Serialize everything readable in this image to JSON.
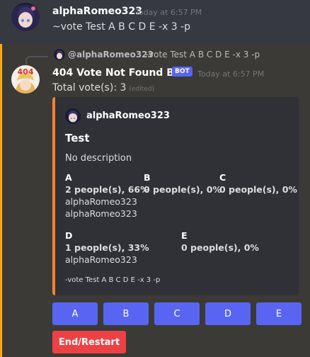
{
  "first_message": {
    "author": "alphaRomeo323",
    "timestamp": "Today at 6:57 PM",
    "content": "~vote Test A B C D E -x 3 -p"
  },
  "reply_reference": {
    "author": "@alphaRomeo323",
    "content": "-vote Test A B C D E -x 3 -p"
  },
  "bot_message": {
    "author": "404 Vote Not Found Bot",
    "badge": "BOT",
    "timestamp": "Today at 6:57 PM",
    "content": "Total vote(s): 3",
    "edited": "(edited)",
    "avatar_text": "404"
  },
  "embed": {
    "author": "alphaRomeo323",
    "title": "Test",
    "description": "No description",
    "fields": [
      {
        "name": "A",
        "summary": "2 people(s), 66%",
        "voters": [
          "alphaRomeo323",
          "alphaRomeo323"
        ]
      },
      {
        "name": "B",
        "summary": "0 people(s), 0%",
        "voters": []
      },
      {
        "name": "C",
        "summary": "0 people(s), 0%",
        "voters": []
      },
      {
        "name": "D",
        "summary": "1 people(s), 33%",
        "voters": [
          "alphaRomeo323"
        ]
      },
      {
        "name": "E",
        "summary": "0 people(s), 0%",
        "voters": []
      }
    ],
    "footer": "-vote Test A B C D E -x 3 -p",
    "accent_color": "#f6812f"
  },
  "buttons": {
    "options": [
      "A",
      "B",
      "C",
      "D",
      "E"
    ],
    "end_restart": "End/Restart"
  },
  "colors": {
    "background": "#36393f",
    "highlight": "#3b3a37",
    "mention_bar": "#faa81a",
    "blurple": "#5865f2",
    "danger": "#ed4245"
  }
}
